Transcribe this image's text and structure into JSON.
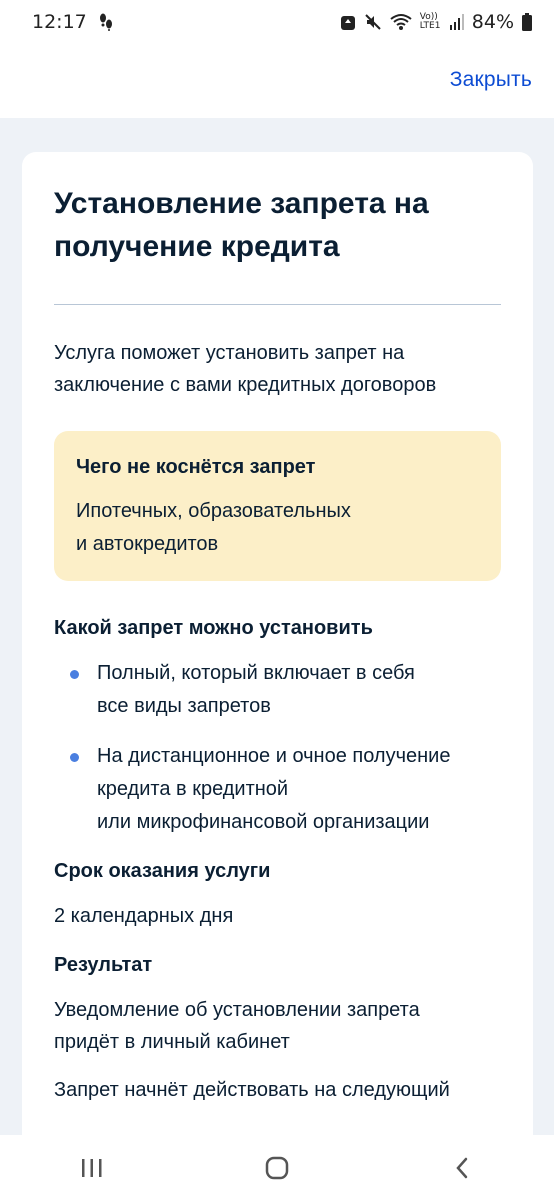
{
  "status_bar": {
    "time": "12:17",
    "battery": "84%",
    "volte_label": "Vo)) LTE1"
  },
  "header": {
    "close_label": "Закрыть"
  },
  "card": {
    "title_line1": "Установление запрета на",
    "title_line2": "получение кредита",
    "intro_line1": "Услуга поможет установить запрет на",
    "intro_line2": "заключение с вами кредитных договоров",
    "notice": {
      "title": "Чего не коснётся запрет",
      "text_line1": "Ипотечных, образовательных",
      "text_line2": "и автокредитов"
    },
    "types_title": "Какой запрет можно установить",
    "types": [
      {
        "line1": "Полный, который включает в себя",
        "line2": "все виды запретов",
        "line3": ""
      },
      {
        "line1": "На дистанционное и очное получение",
        "line2": "кредита в кредитной",
        "line3": "или микрофинансовой организации"
      }
    ],
    "term_title": "Срок оказания услуги",
    "term_value": "2 календарных дня",
    "result_title": "Результат",
    "result_line1": "Уведомление об установлении запрета",
    "result_line2": "придёт в личный кабинет",
    "result_more": "Запрет начнёт действовать на следующий"
  },
  "colors": {
    "accent": "#0d4cd3",
    "notice_bg": "#fcefc8",
    "bullet": "#4a7fe0",
    "page_bg": "#eef2f7"
  },
  "nav": {
    "icons": [
      "recent-apps-icon",
      "home-icon",
      "back-icon"
    ]
  }
}
